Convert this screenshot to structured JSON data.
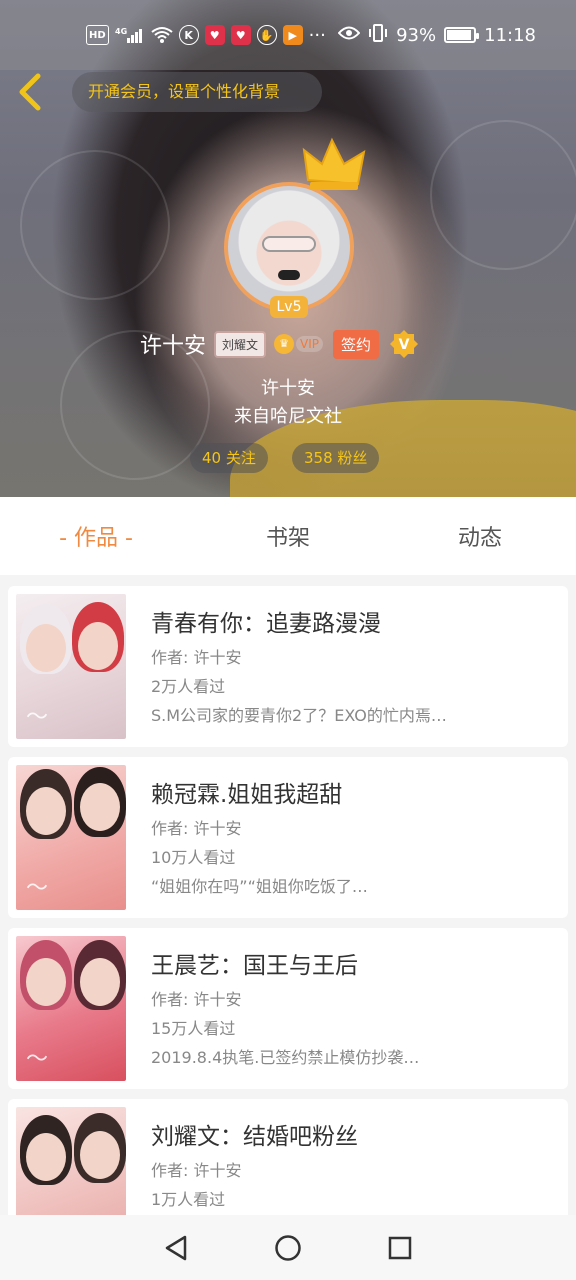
{
  "status_bar": {
    "left_icons": [
      "hd",
      "4g-signal",
      "wifi",
      "k-app",
      "heart-app",
      "heart-app",
      "hand-app",
      "play-app",
      "more"
    ],
    "hd_label": "HD",
    "net_label": "4G",
    "more_label": "···",
    "battery_percent": 93,
    "battery_label": "93%",
    "time": "11:18"
  },
  "header": {
    "vip_banner": "开通会员，设置个性化背景",
    "level": "Lv5",
    "user_name": "许十安",
    "fan_tag": "刘耀文",
    "vip_label": "VIP",
    "sign_label": "签约",
    "v_label": "V",
    "author_name": "许十安",
    "author_org": "来自哈尼文社",
    "following": "40 关注",
    "fans": "358 粉丝"
  },
  "tabs": [
    {
      "label": "- 作品 -",
      "active": true
    },
    {
      "label": "书架",
      "active": false
    },
    {
      "label": "动态",
      "active": false
    }
  ],
  "books": [
    {
      "title": "青春有你：追妻路漫漫",
      "author": "作者: 许十安",
      "views": "2万人看过",
      "intro": "S.M公司家的要青你2了？EXO的忙内焉…"
    },
    {
      "title": "赖冠霖.姐姐我超甜",
      "author": "作者: 许十安",
      "views": "10万人看过",
      "intro": "“姐姐你在吗”“姐姐你吃饭了…"
    },
    {
      "title": "王晨艺：国王与王后",
      "author": "作者: 许十安",
      "views": "15万人看过",
      "intro": "2019.8.4执笔.已签约禁止模仿抄袭…"
    },
    {
      "title": "刘耀文：结婚吧粉丝",
      "author": "作者: 许十安",
      "views": "1万人看过",
      "intro": ""
    }
  ],
  "colors": {
    "accent": "#f08a40",
    "gold": "#f5c518",
    "sign": "#ef6c45"
  }
}
